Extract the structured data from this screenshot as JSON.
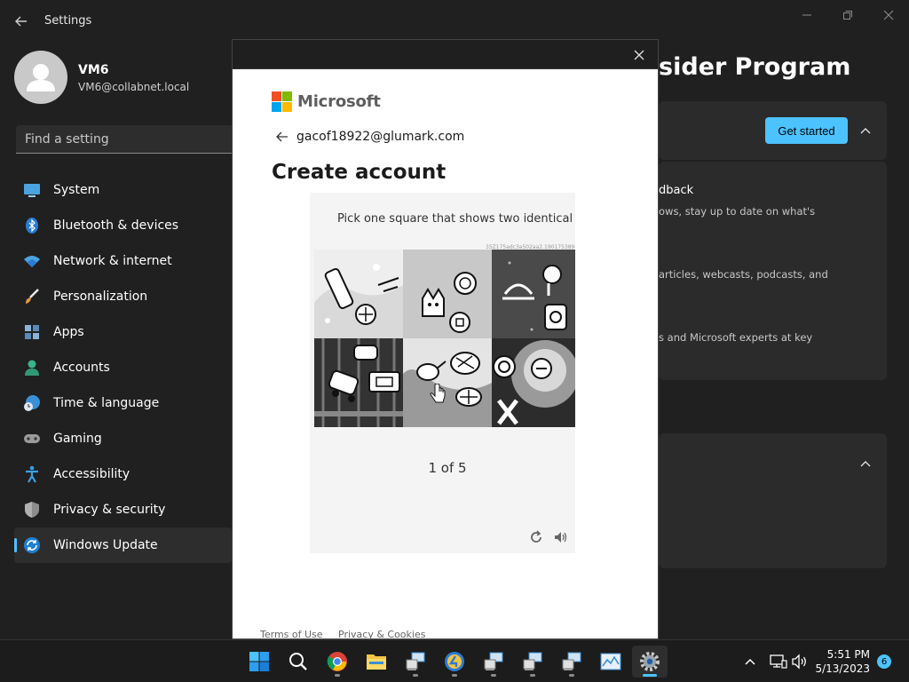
{
  "window": {
    "title": "Settings"
  },
  "profile": {
    "name": "VM6",
    "email": "VM6@collabnet.local"
  },
  "search": {
    "placeholder": "Find a setting"
  },
  "nav": {
    "items": [
      {
        "label": "System",
        "icon": "monitor-icon"
      },
      {
        "label": "Bluetooth & devices",
        "icon": "bluetooth-icon"
      },
      {
        "label": "Network & internet",
        "icon": "wifi-icon"
      },
      {
        "label": "Personalization",
        "icon": "brush-icon"
      },
      {
        "label": "Apps",
        "icon": "apps-icon"
      },
      {
        "label": "Accounts",
        "icon": "person-icon"
      },
      {
        "label": "Time & language",
        "icon": "globe-clock-icon"
      },
      {
        "label": "Gaming",
        "icon": "gamepad-icon"
      },
      {
        "label": "Accessibility",
        "icon": "accessibility-icon"
      },
      {
        "label": "Privacy & security",
        "icon": "shield-icon"
      },
      {
        "label": "Windows Update",
        "icon": "update-icon",
        "active": true
      }
    ]
  },
  "main": {
    "heading": "sider Program",
    "get_started": "Get started",
    "card_lines": {
      "feedback_title": "dback",
      "feedback_desc": "ows, stay up to date on what's",
      "articles": "articles, webcasts, podcasts, and",
      "experts": "s and Microsoft experts at key"
    }
  },
  "dialog": {
    "brand": "Microsoft",
    "email": "gacof18922@glumark.com",
    "title": "Create account",
    "captcha": {
      "prompt": "Pick one square that shows two identical objects.",
      "session_id": "35Z175adc3a502aa2.1901753896",
      "progress": "1 of 5",
      "selected_tile": 4
    },
    "footer": {
      "terms": "Terms of Use",
      "privacy": "Privacy & Cookies"
    }
  },
  "taskbar": {
    "apps": [
      "start-icon",
      "search-icon",
      "chrome-icon",
      "file-explorer-icon",
      "remote-desktop-icon",
      "app-4-icon",
      "remote-desktop-icon",
      "remote-desktop-icon",
      "remote-desktop-icon",
      "task-manager-icon",
      "settings-icon"
    ],
    "time": "5:51 PM",
    "date": "5/13/2023",
    "notifications": "6"
  },
  "colors": {
    "accent": "#4cc2ff",
    "background": "#202020"
  }
}
